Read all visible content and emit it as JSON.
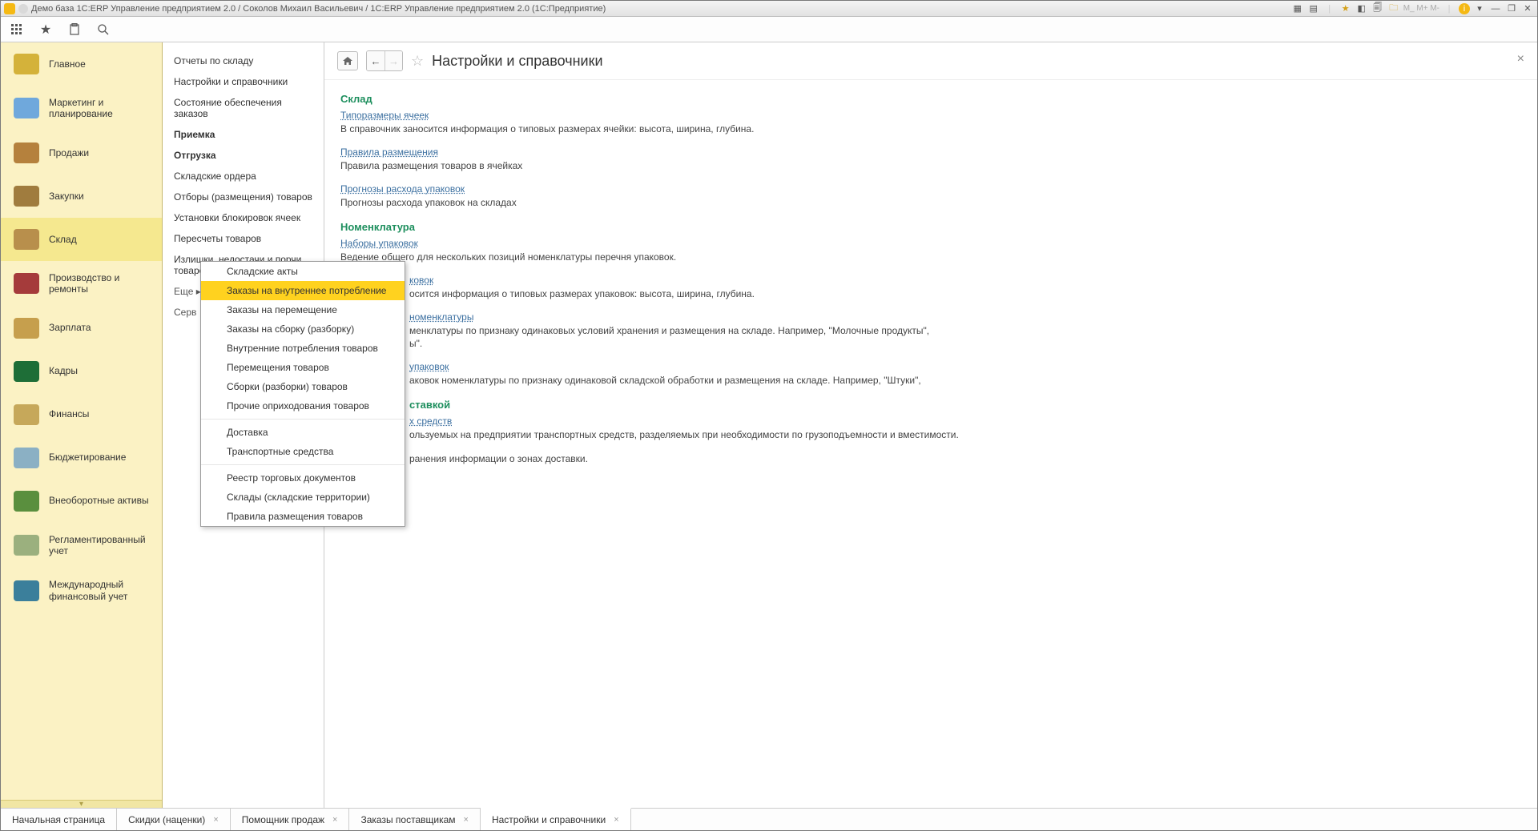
{
  "window": {
    "title": "Демо база 1С:ERP Управление предприятием 2.0 / Соколов Михаил Васильевич / 1С:ERP Управление предприятием 2.0  (1С:Предприятие)"
  },
  "sidebar": {
    "items": [
      {
        "label": "Главное",
        "color": "#d4b23a"
      },
      {
        "label": "Маркетинг и\nпланирование",
        "color": "#6fa8dc"
      },
      {
        "label": "Продажи",
        "color": "#b5813d"
      },
      {
        "label": "Закупки",
        "color": "#a07c3e"
      },
      {
        "label": "Склад",
        "color": "#b88f4c",
        "active": true
      },
      {
        "label": "Производство и ремонты",
        "color": "#a53b3b"
      },
      {
        "label": "Зарплата",
        "color": "#c69f4d"
      },
      {
        "label": "Кадры",
        "color": "#1e6e37"
      },
      {
        "label": "Финансы",
        "color": "#c6a85a"
      },
      {
        "label": "Бюджетирование",
        "color": "#8bb0c4"
      },
      {
        "label": "Внеоборотные активы",
        "color": "#5a8f3e"
      },
      {
        "label": "Регламентированный учет",
        "color": "#9bb07e"
      },
      {
        "label": "Международный\nфинансовый учет",
        "color": "#3b7f9b"
      }
    ]
  },
  "nav2": {
    "items": [
      {
        "label": "Отчеты по складу"
      },
      {
        "label": "Настройки и справочники"
      },
      {
        "label": "Состояние обеспечения заказов"
      },
      {
        "label": "Приемка",
        "bold": true
      },
      {
        "label": "Отгрузка",
        "bold": true
      },
      {
        "label": "Складские ордера"
      },
      {
        "label": "Отборы (размещения) товаров"
      },
      {
        "label": "Установки блокировок ячеек"
      },
      {
        "label": "Пересчеты товаров"
      },
      {
        "label": "Излишки, недостачи и порчи товаров"
      }
    ],
    "more_label": "Еще ▸",
    "service_label": "Серв"
  },
  "popup": {
    "items": [
      {
        "label": "Складские акты"
      },
      {
        "label": "Заказы на внутреннее потребление",
        "hl": true
      },
      {
        "label": "Заказы на перемещение"
      },
      {
        "label": "Заказы на сборку (разборку)"
      },
      {
        "label": "Внутренние потребления товаров"
      },
      {
        "label": "Перемещения товаров"
      },
      {
        "label": "Сборки (разборки) товаров"
      },
      {
        "label": "Прочие оприходования товаров"
      },
      {
        "label": "Доставка",
        "gap_before": true
      },
      {
        "label": "Транспортные средства"
      },
      {
        "label": "Реестр торговых документов",
        "gap_before": true
      },
      {
        "label": "Склады (складские территории)"
      },
      {
        "label": "Правила размещения товаров"
      }
    ]
  },
  "content": {
    "title": "Настройки и справочники",
    "sections": [
      {
        "heading": "Склад",
        "rows": [
          {
            "link": "Типоразмеры ячеек",
            "desc": "В справочник заносится информация о типовых размерах ячейки: высота, ширина, глубина."
          },
          {
            "link": "Правила размещения",
            "desc": "Правила размещения товаров в ячейках"
          },
          {
            "link": "Прогнозы расхода упаковок",
            "desc": "Прогнозы расхода упаковок на складах"
          }
        ]
      },
      {
        "heading": "Номенклатура",
        "rows": [
          {
            "link": "Наборы упаковок",
            "desc": "Ведение общего для нескольких позиций номенклатуры перечня упаковок."
          },
          {
            "link": "ковок",
            "link_partial": true,
            "desc": "осится информация о типовых размерах упаковок: высота, ширина, глубина."
          },
          {
            "link": "номенклатуры",
            "link_partial": true,
            "desc": "менклатуры по признаку одинаковых условий хранения и размещения на складе. Например, \"Молочные продукты\",\nы\"."
          },
          {
            "link": "упаковок",
            "link_partial": true,
            "desc": "аковок номенклатуры по признаку одинаковой складской обработки и размещения на складе. Например, \"Штуки\",\n"
          }
        ]
      },
      {
        "heading_partial": "ставкой",
        "rows": [
          {
            "link": "х средств",
            "link_partial": true,
            "desc": "ользуемых на предприятии транспортных средств, разделяемых при необходимости по грузоподъемности и вместимости."
          },
          {
            "link": "",
            "desc": "ранения информации о зонах доставки."
          }
        ]
      }
    ]
  },
  "tabs": {
    "items": [
      {
        "label": "Начальная страница",
        "closable": false
      },
      {
        "label": "Скидки (наценки)",
        "closable": true
      },
      {
        "label": "Помощник продаж",
        "closable": true
      },
      {
        "label": "Заказы поставщикам",
        "closable": true
      },
      {
        "label": "Настройки и справочники",
        "closable": true,
        "active": true
      }
    ]
  }
}
